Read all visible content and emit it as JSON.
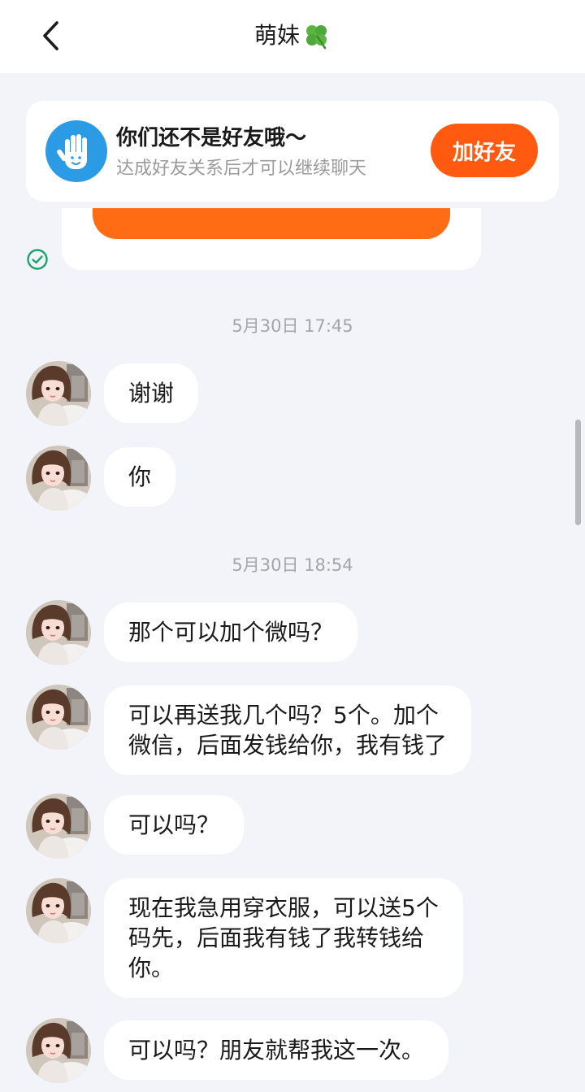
{
  "header": {
    "title": "萌妹",
    "title_emoji_icon": "four-leaf-clover-icon",
    "back_icon": "chevron-left-icon"
  },
  "banner": {
    "icon": "waving-hand-icon",
    "title": "你们还不是好友哦～",
    "subtitle": "达成好友关系后才可以继续聊天",
    "button_label": "加好友",
    "accent_color": "#ff5a0f"
  },
  "sent_status_icon": "check-circle-icon",
  "timestamps": [
    "5月30日 17:45",
    "5月30日 18:54"
  ],
  "messages": [
    {
      "text": "谢谢"
    },
    {
      "text": "你"
    },
    {
      "text": "那个可以加个微吗？"
    },
    {
      "text": "可以再送我几个吗？5个。加个\n微信，后面发钱给你，我有钱了"
    },
    {
      "text": "可以吗？"
    },
    {
      "text": "现在我急用穿衣服，可以送5个\n码先，后面我有钱了我转钱给\n你。"
    },
    {
      "text": "可以吗？朋友就帮我这一次。"
    }
  ]
}
